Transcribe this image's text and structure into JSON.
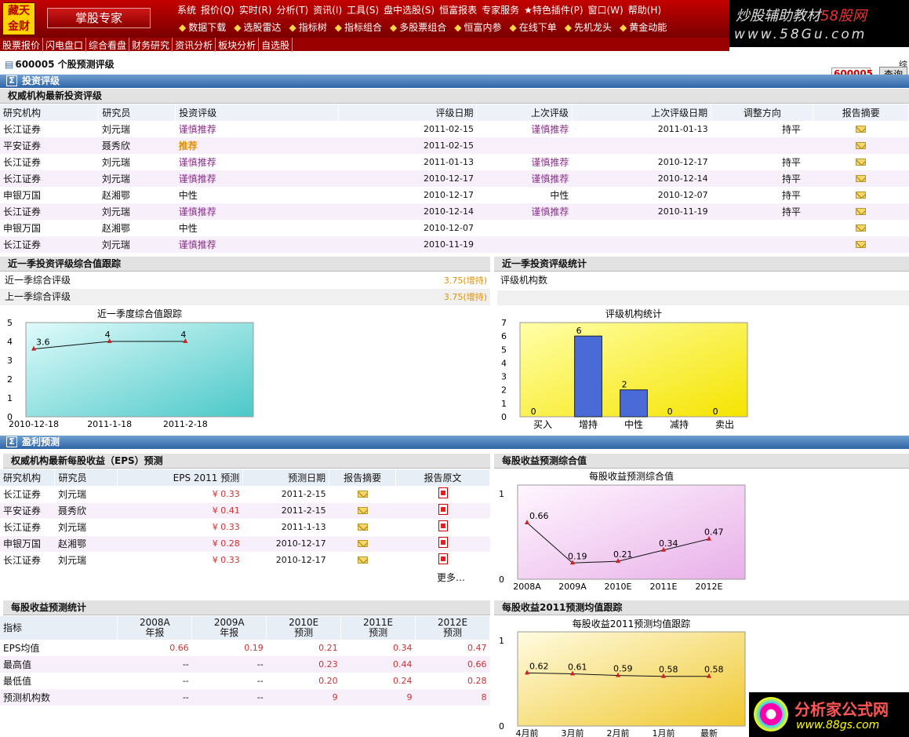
{
  "app": {
    "logo": "藏天金财",
    "name": "掌股专家"
  },
  "menu": [
    "系统",
    "报价(Q)",
    "实时(R)",
    "分析(T)",
    "资讯(I)",
    "工具(S)",
    "盘中选股(S)",
    "恒富报表",
    "专家服务",
    "★特色插件(P)",
    "窗口(W)",
    "帮助(H)"
  ],
  "toolbar": [
    "数据下载",
    "选股雷达",
    "指标树",
    "指标组合",
    "多股票组合",
    "恒富内参",
    "在线下单",
    "先机龙头",
    "黄金动能"
  ],
  "tabs": [
    "股票报价",
    "闪电盘口",
    "综合看盘",
    "财务研究",
    "资讯分析",
    "板块分析",
    "自选股"
  ],
  "brand": {
    "line1a": "炒股辅助教材",
    "line1b": "58股网",
    "line2": "www.58Gu.com"
  },
  "stock": {
    "title": "600005 个股预测评级",
    "code": "600005",
    "query": "查询",
    "frag": "综"
  },
  "sec1": {
    "title": "投资评级",
    "sub": "权威机构最新投资评级"
  },
  "ratings": {
    "headers": [
      "研究机构",
      "研究员",
      "投资评级",
      "评级日期",
      "上次评级",
      "上次评级日期",
      "调整方向",
      "报告摘要"
    ],
    "rows": [
      {
        "inst": "长江证券",
        "analyst": "刘元瑞",
        "rating": "谨慎推荐",
        "date": "2011-02-15",
        "prev": "谨慎推荐",
        "prev_date": "2011-01-13",
        "dir": "持平"
      },
      {
        "inst": "平安证券",
        "analyst": "聂秀欣",
        "rating": "推荐",
        "date": "2011-02-15",
        "prev": "",
        "prev_date": "",
        "dir": ""
      },
      {
        "inst": "长江证券",
        "analyst": "刘元瑞",
        "rating": "谨慎推荐",
        "date": "2011-01-13",
        "prev": "谨慎推荐",
        "prev_date": "2010-12-17",
        "dir": "持平"
      },
      {
        "inst": "长江证券",
        "analyst": "刘元瑞",
        "rating": "谨慎推荐",
        "date": "2010-12-17",
        "prev": "谨慎推荐",
        "prev_date": "2010-12-14",
        "dir": "持平"
      },
      {
        "inst": "申银万国",
        "analyst": "赵湘鄂",
        "rating": "中性",
        "date": "2010-12-17",
        "prev": "中性",
        "prev_date": "2010-12-07",
        "dir": "持平"
      },
      {
        "inst": "长江证券",
        "analyst": "刘元瑞",
        "rating": "谨慎推荐",
        "date": "2010-12-14",
        "prev": "谨慎推荐",
        "prev_date": "2010-11-19",
        "dir": "持平"
      },
      {
        "inst": "申银万国",
        "analyst": "赵湘鄂",
        "rating": "中性",
        "date": "2010-12-07",
        "prev": "",
        "prev_date": "",
        "dir": ""
      },
      {
        "inst": "长江证券",
        "analyst": "刘元瑞",
        "rating": "谨慎推荐",
        "date": "2010-11-19",
        "prev": "",
        "prev_date": "",
        "dir": ""
      }
    ]
  },
  "track": {
    "title": "近一季投资评级综合值跟踪",
    "row1": "近一季综合评级",
    "row1v": "3.75(增持)",
    "row2": "上一季综合评级",
    "row2v": "3.75(增持)"
  },
  "stat": {
    "title": "近一季投资评级统计",
    "row1": "评级机构数"
  },
  "sec2": {
    "title": "盈利预测",
    "sub": "权威机构最新每股收益（EPS）预测"
  },
  "eps": {
    "headers": [
      "研究机构",
      "研究员",
      "EPS 2011 预测",
      "预测日期",
      "报告摘要",
      "报告原文"
    ],
    "rows": [
      {
        "inst": "长江证券",
        "analyst": "刘元瑞",
        "eps": "¥ 0.33",
        "date": "2011-2-15"
      },
      {
        "inst": "平安证券",
        "analyst": "聂秀欣",
        "eps": "¥ 0.41",
        "date": "2011-2-15"
      },
      {
        "inst": "长江证券",
        "analyst": "刘元瑞",
        "eps": "¥ 0.33",
        "date": "2011-1-13"
      },
      {
        "inst": "申银万国",
        "analyst": "赵湘鄂",
        "eps": "¥ 0.28",
        "date": "2010-12-17"
      },
      {
        "inst": "长江证券",
        "analyst": "刘元瑞",
        "eps": "¥ 0.33",
        "date": "2010-12-17"
      }
    ],
    "more": "更多…"
  },
  "epsstat": {
    "title": "每股收益预测统计",
    "headers": [
      {
        "a": "指标",
        "b": ""
      },
      {
        "a": "2008A",
        "b": "年报"
      },
      {
        "a": "2009A",
        "b": "年报"
      },
      {
        "a": "2010E",
        "b": "预测"
      },
      {
        "a": "2011E",
        "b": "预测"
      },
      {
        "a": "2012E",
        "b": "预测"
      }
    ],
    "rows": [
      [
        "EPS均值",
        "0.66",
        "0.19",
        "0.21",
        "0.34",
        "0.47"
      ],
      [
        "最高值",
        "--",
        "--",
        "0.23",
        "0.44",
        "0.66"
      ],
      [
        "最低值",
        "--",
        "--",
        "0.20",
        "0.24",
        "0.28"
      ],
      [
        "预测机构数",
        "--",
        "--",
        "9",
        "9",
        "8"
      ]
    ]
  },
  "epscomp_title": "每股收益预测综合值",
  "eps2011_title": "每股收益2011预测均值跟踪",
  "watermark": {
    "t1": "分析家公式网",
    "t2": "www.88gs.com"
  },
  "chart_data": [
    {
      "type": "line",
      "title": "近一季度综合值跟踪",
      "x": [
        "2010-12-18",
        "2011-1-18",
        "2011-2-18"
      ],
      "values": [
        3.6,
        4,
        4
      ],
      "labels": [
        "3.6",
        "4",
        "4"
      ],
      "ylim": [
        0,
        5
      ],
      "yticks": [
        "0",
        "1",
        "2",
        "3",
        "4",
        "5"
      ],
      "color": "#cc2222"
    },
    {
      "type": "bar",
      "title": "评级机构统计",
      "categories": [
        "买入",
        "增持",
        "中性",
        "减持",
        "卖出"
      ],
      "values": [
        0,
        6,
        2,
        0,
        0
      ],
      "ylim": [
        0,
        7
      ],
      "yticks": [
        "0",
        "1",
        "2",
        "3",
        "4",
        "5",
        "6",
        "7"
      ],
      "color": "#6655dd"
    },
    {
      "type": "line",
      "title": "每股收益预测综合值",
      "x": [
        "2008A",
        "2009A",
        "2010E",
        "2011E",
        "2012E"
      ],
      "values": [
        0.66,
        0.19,
        0.21,
        0.34,
        0.47
      ],
      "labels": [
        "0.66",
        "0.19",
        "0.21",
        "0.34",
        "0.47"
      ],
      "ylim": [
        0,
        1.1
      ],
      "yticks": [
        "0",
        "1"
      ],
      "color": "#cc2222"
    },
    {
      "type": "line",
      "title": "每股收益2011预测均值跟踪",
      "x": [
        "4月前",
        "3月前",
        "2月前",
        "1月前",
        "最新"
      ],
      "values": [
        0.62,
        0.61,
        0.59,
        0.58,
        0.58
      ],
      "labels": [
        "0.62",
        "0.61",
        "0.59",
        "0.58",
        "0.58"
      ],
      "ylim": [
        0,
        1.1
      ],
      "yticks": [
        "0",
        "1"
      ],
      "color": "#cc2222"
    }
  ]
}
